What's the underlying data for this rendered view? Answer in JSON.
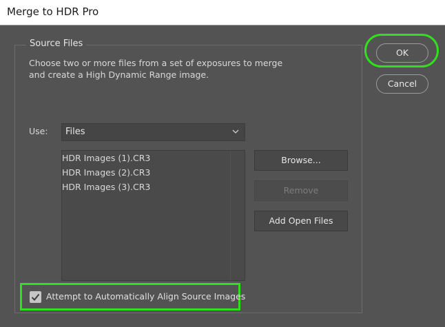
{
  "window": {
    "title": "Merge to HDR Pro"
  },
  "source_files": {
    "group_title": "Source Files",
    "description": "Choose two or more files from a set of exposures to merge and create a High Dynamic Range image.",
    "use_label": "Use:",
    "use_value": "Files",
    "files": [
      "HDR Images (1).CR3",
      "HDR Images (2).CR3",
      "HDR Images (3).CR3"
    ],
    "browse_label": "Browse...",
    "remove_label": "Remove",
    "add_open_files_label": "Add Open Files",
    "align_label": "Attempt to Automatically Align Source Images",
    "align_checked": true
  },
  "actions": {
    "ok_label": "OK",
    "cancel_label": "Cancel"
  },
  "colors": {
    "highlight": "#31e01c",
    "dialog_bg": "#535353"
  }
}
